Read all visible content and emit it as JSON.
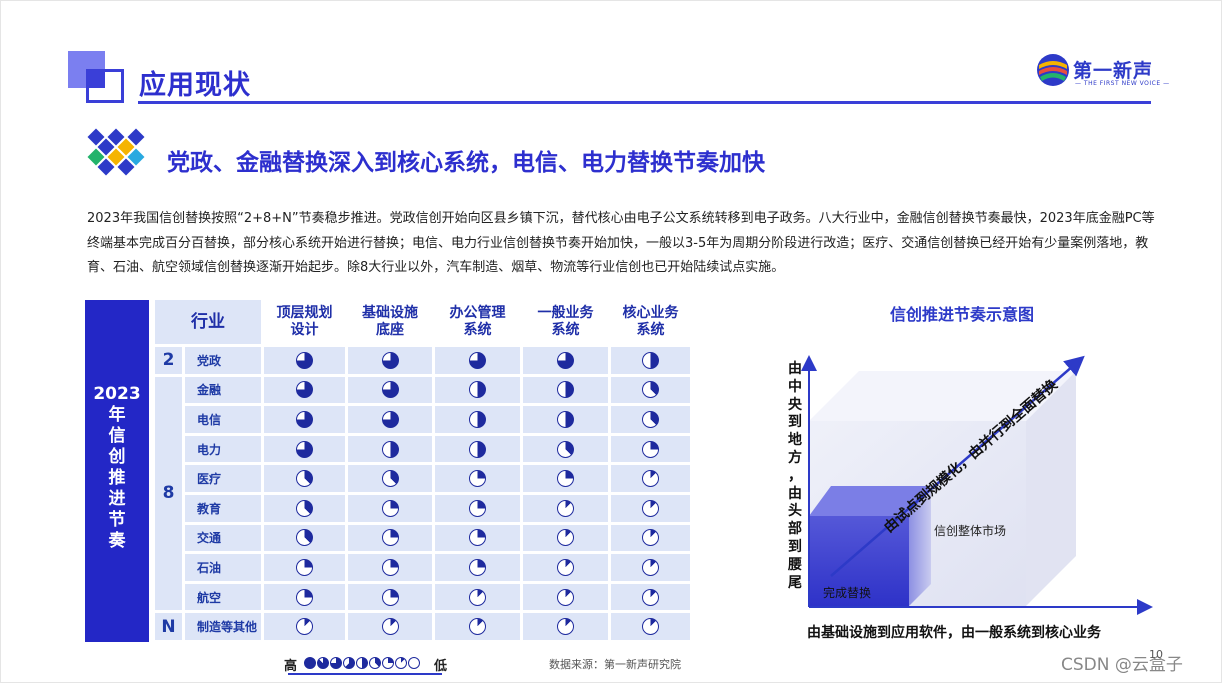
{
  "header": {
    "title": "应用现状",
    "logo_cn": "第一新声",
    "logo_en": "THE FIRST NEW VOICE"
  },
  "section": {
    "subtitle": "党政、金融替换深入到核心系统，电信、电力替换节奏加快",
    "paragraph": "2023年我国信创替换按照“2+8+N”节奏稳步推进。党政信创开始向区县乡镇下沉，替代核心由电子公文系统转移到电子政务。八大行业中，金融信创替换节奏最快，2023年底金融PC等终端基本完成百分百替换，部分核心系统开始进行替换；电信、电力行业信创替换节奏开始加快，一般以3-5年为周期分阶段进行改造；医疗、交通信创替换已经开始有少量案例落地，教育、石油、航空领域信创替换逐渐开始起步。除8大行业以外，汽车制造、烟草、物流等行业信创也已开始陆续试点实施。"
  },
  "table": {
    "side_label": "2023年信创推进节奏",
    "industry_header": "行业",
    "columns": [
      "顶层规划\n设计",
      "基础设施\n底座",
      "办公管理\n系统",
      "一般业务\n系统",
      "核心业务\n系统"
    ],
    "groups": [
      {
        "label": "2",
        "rows": 1
      },
      {
        "label": "8",
        "rows": 8
      },
      {
        "label": "N",
        "rows": 1
      }
    ],
    "rows": [
      {
        "industry": "党政",
        "levels": [
          75,
          75,
          75,
          75,
          50
        ]
      },
      {
        "industry": "金融",
        "levels": [
          75,
          75,
          50,
          50,
          37
        ]
      },
      {
        "industry": "电信",
        "levels": [
          75,
          75,
          50,
          50,
          37
        ]
      },
      {
        "industry": "电力",
        "levels": [
          75,
          50,
          50,
          37,
          25
        ]
      },
      {
        "industry": "医疗",
        "levels": [
          37,
          37,
          25,
          25,
          12
        ]
      },
      {
        "industry": "教育",
        "levels": [
          37,
          25,
          25,
          12,
          12
        ]
      },
      {
        "industry": "交通",
        "levels": [
          37,
          25,
          25,
          12,
          12
        ]
      },
      {
        "industry": "石油",
        "levels": [
          25,
          25,
          25,
          12,
          12
        ]
      },
      {
        "industry": "航空",
        "levels": [
          25,
          25,
          12,
          12,
          12
        ]
      },
      {
        "industry": "制造等其他",
        "levels": [
          12,
          12,
          12,
          12,
          12
        ]
      }
    ],
    "legend": {
      "high": "高",
      "low": "低",
      "levels": [
        100,
        87,
        75,
        62,
        50,
        37,
        25,
        12,
        0
      ]
    },
    "source": "数据来源：第一新声研究院"
  },
  "diagram": {
    "title": "信创推进节奏示意图",
    "y_axis": "由中央到地方，由头部到腰尾",
    "x_axis": "由基础设施到应用软件，由一般系统到核心业务",
    "diagonal": "由试点到规模化，由并行到全面替换",
    "outer_label": "信创整体市场",
    "inner_label": "完成替换"
  },
  "footer": {
    "page_number": "10",
    "watermark": "CSDN @云盒子"
  },
  "colors": {
    "primary": "#2d2fce",
    "band": "#2327c6",
    "cell": "#dde5f7"
  }
}
